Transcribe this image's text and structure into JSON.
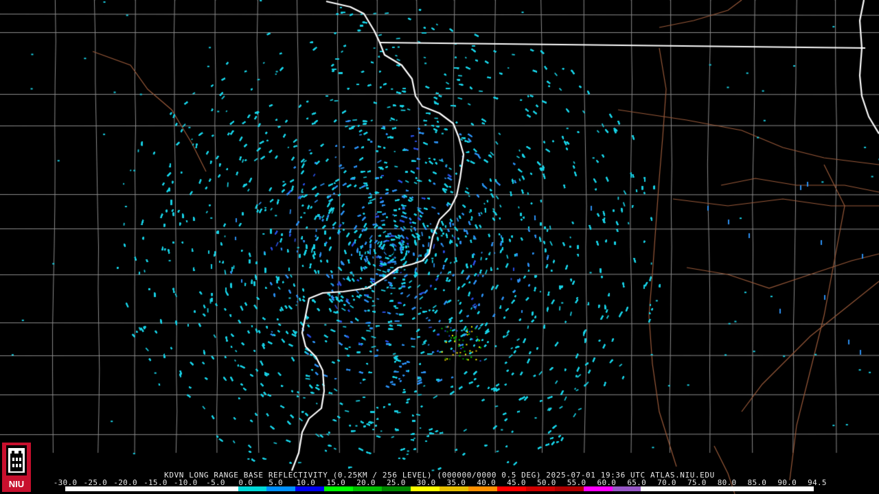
{
  "product": {
    "caption": "KDVN LONG RANGE BASE REFLECTIVITY (0.25KM / 256 LEVEL) (000000/0000 0.5 DEG) 2025-07-01 19:36 UTC  ATLAS.NIU.EDU",
    "radar_site": "KDVN",
    "timestamp": "2025-07-01 19:36 UTC",
    "source": "ATLAS.NIU.EDU"
  },
  "logo": {
    "text": "NIU",
    "icon": "niu-tower-logo"
  },
  "legend": {
    "ticks": [
      "-30.0",
      "-25.0",
      "-20.0",
      "-15.0",
      "-10.0",
      "-5.0",
      "0.0",
      "5.0",
      "10.0",
      "15.0",
      "20.0",
      "25.0",
      "30.0",
      "35.0",
      "40.0",
      "45.0",
      "50.0",
      "55.0",
      "60.0",
      "65.0",
      "70.0",
      "75.0",
      "80.0",
      "85.0",
      "90.0",
      "94.5"
    ],
    "colors": [
      "#ffffff",
      "#ffffff",
      "#ffffff",
      "#ffffff",
      "#ffffff",
      "#ffffff",
      "#00d8d8",
      "#0090ff",
      "#0000f0",
      "#00ff00",
      "#00c000",
      "#008800",
      "#ffff00",
      "#e8c000",
      "#ff9000",
      "#ff0000",
      "#d00000",
      "#b00000",
      "#ff00ff",
      "#9858c8",
      "#ffffff",
      "#ffffff",
      "#ffffff",
      "#ffffff",
      "#ffffff",
      "#ffffff"
    ]
  },
  "colors": {
    "background": "#000000",
    "county_lines": "#8c8c8c",
    "state_lines": "#ffffff",
    "roads": "#9a5a3a",
    "echo_light": "#19d2e6",
    "echo_mid": "#2c8ff0",
    "echo_heavy": "#2a4fe0"
  }
}
